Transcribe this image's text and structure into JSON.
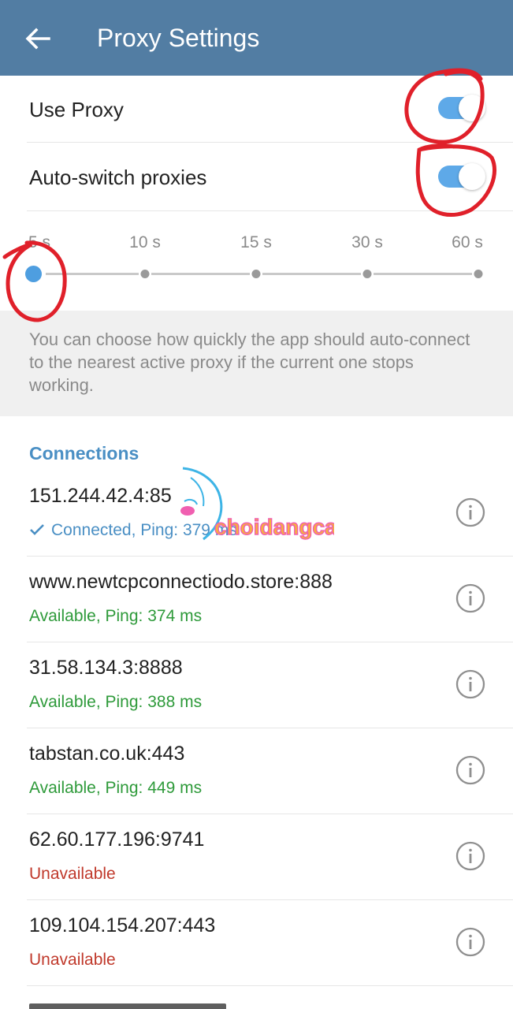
{
  "appbar": {
    "title": "Proxy Settings",
    "back_icon": "arrow-left-icon",
    "bg": "#527da3"
  },
  "settings": {
    "use_proxy": {
      "label": "Use Proxy",
      "on": true
    },
    "auto_switch": {
      "label": "Auto-switch proxies",
      "on": true
    }
  },
  "slider": {
    "ticks": [
      "5 s",
      "10 s",
      "15 s",
      "30 s",
      "60 s"
    ],
    "selected": "5 s"
  },
  "info": {
    "text": "You can choose how quickly the app should auto-connect to the nearest active proxy if the current one stops working."
  },
  "connections": {
    "title": "Connections",
    "items": [
      {
        "address": "151.244.42.4:85",
        "status": "Connected, Ping: 379 ms",
        "state": "connected",
        "color": "#4a8fc4"
      },
      {
        "address": "www.newtcpconnectiodo.store:888",
        "status": "Available, Ping: 374 ms",
        "state": "available",
        "color": "#2e9a3a"
      },
      {
        "address": "31.58.134.3:8888",
        "status": "Available, Ping: 388 ms",
        "state": "available",
        "color": "#2e9a3a"
      },
      {
        "address": "tabstan.co.uk:443",
        "status": "Available, Ping: 449 ms",
        "state": "available",
        "color": "#2e9a3a"
      },
      {
        "address": "62.60.177.196:9741",
        "status": "Unavailable",
        "state": "unavailable",
        "color": "#c0392b"
      },
      {
        "address": "109.104.154.207:443",
        "status": "Unavailable",
        "state": "unavailable",
        "color": "#c0392b"
      }
    ]
  },
  "watermark": {
    "text": "choidangcap"
  },
  "colors": {
    "accent": "#5ea9e8",
    "connected": "#4a8fc4",
    "available": "#2e9a3a",
    "unavailable": "#c0392b",
    "annotation": "#e0202a"
  }
}
